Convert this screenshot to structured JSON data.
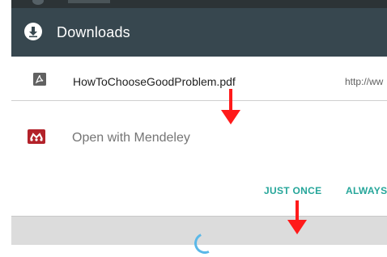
{
  "header": {
    "title": "Downloads",
    "icon": "download-icon",
    "background": "#37474f"
  },
  "download": {
    "filename": "HowToChooseGoodProblem.pdf",
    "url": "http://ww",
    "icon": "pdf-icon"
  },
  "chooser": {
    "app_label": "Open with Mendeley",
    "app_icon": "mendeley-icon",
    "accent": "#26a69a"
  },
  "actions": {
    "just_once": "JUST ONCE",
    "always": "ALWAYS"
  },
  "annotations": {
    "arrow_color": "#ff1a1a"
  }
}
